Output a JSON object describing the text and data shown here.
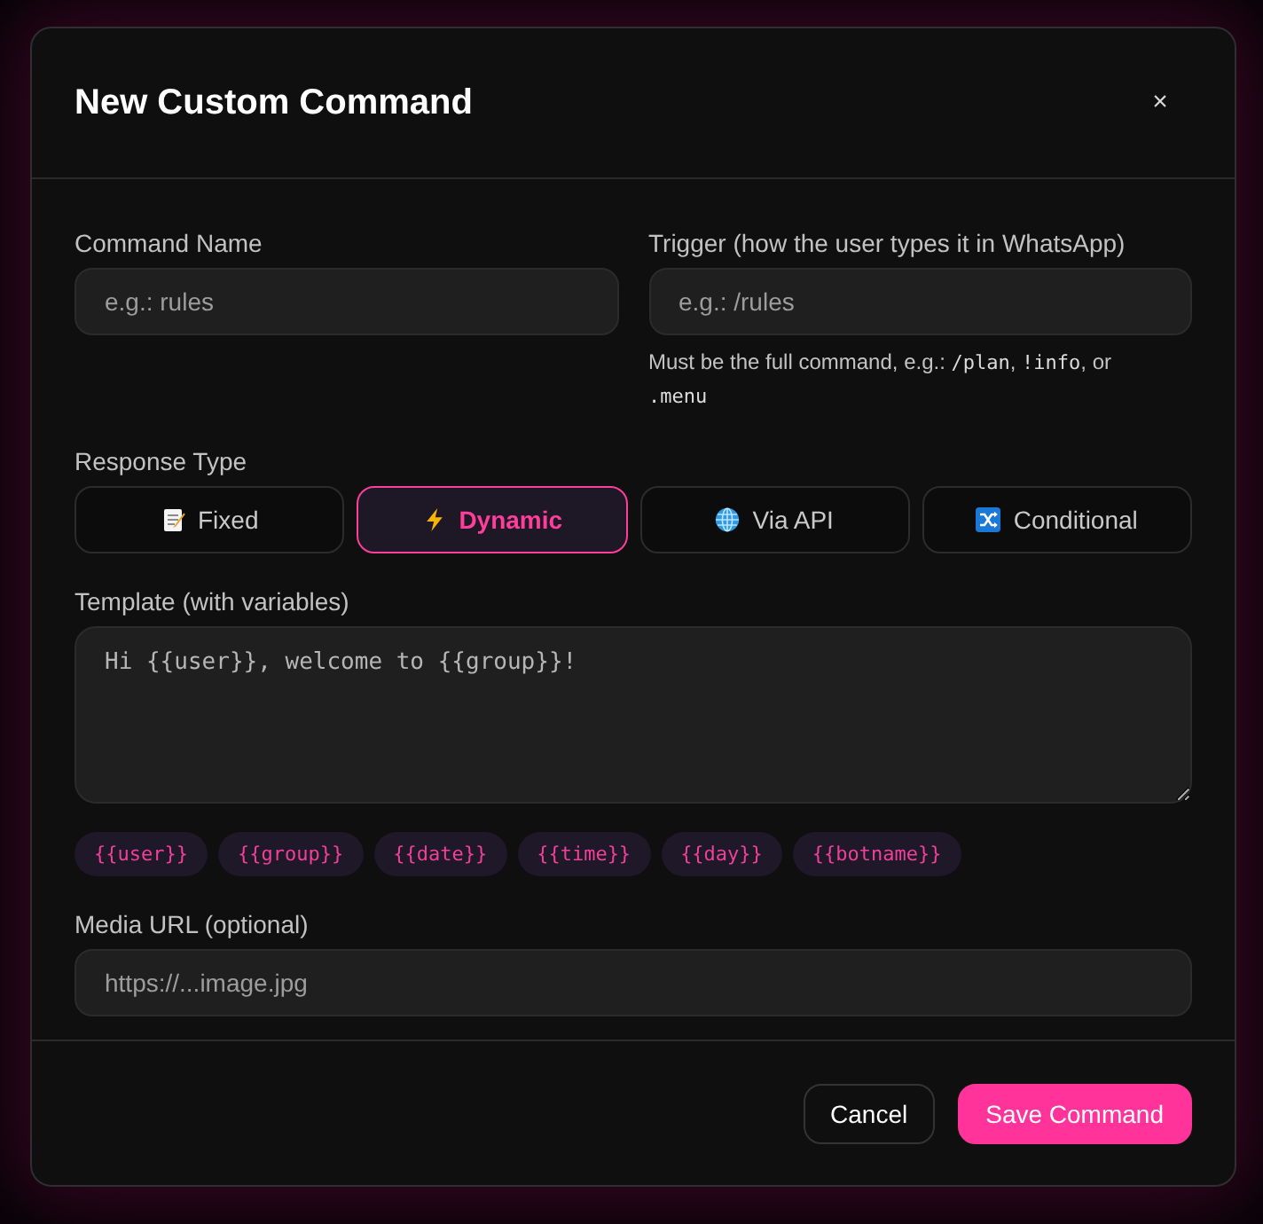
{
  "modal": {
    "title": "New Custom Command",
    "close": "×"
  },
  "command_name": {
    "label": "Command Name",
    "placeholder": "e.g.: rules"
  },
  "trigger": {
    "label": "Trigger (how the user types it in WhatsApp)",
    "placeholder": "e.g.: /rules",
    "help": [
      {
        "kind": "text",
        "text": "Must be the full command, e.g.: "
      },
      {
        "kind": "code",
        "text": "/plan"
      },
      {
        "kind": "text",
        "text": ", "
      },
      {
        "kind": "code",
        "text": "!info"
      },
      {
        "kind": "text",
        "text": ", or "
      },
      {
        "kind": "code",
        "text": ".menu"
      }
    ]
  },
  "response_type": {
    "label": "Response Type",
    "options": [
      {
        "label": "Fixed",
        "selected": false
      },
      {
        "label": "Dynamic",
        "selected": true
      },
      {
        "label": "Via API",
        "selected": false
      },
      {
        "label": "Conditional",
        "selected": false
      }
    ]
  },
  "template": {
    "label": "Template (with variables)",
    "placeholder": "Hi {{user}}, welcome to {{group}}!",
    "variables": [
      "{{user}}",
      "{{group}}",
      "{{date}}",
      "{{time}}",
      "{{day}}",
      "{{botname}}"
    ]
  },
  "media_url": {
    "label": "Media URL (optional)",
    "placeholder": "https://...image.jpg"
  },
  "footer": {
    "buttons": [
      {
        "label": "Cancel",
        "kind": "secondary"
      },
      {
        "label": "Save Command",
        "kind": "primary"
      }
    ]
  }
}
